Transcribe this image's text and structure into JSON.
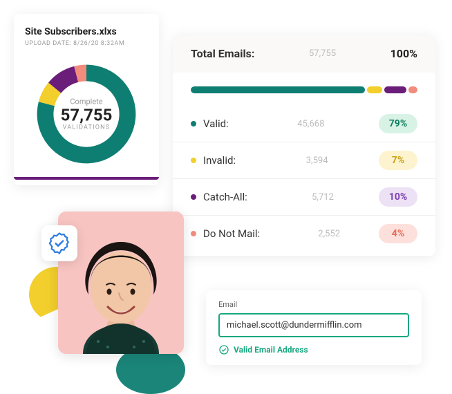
{
  "subs": {
    "title": "Site Subscribers.xlxs",
    "upload_meta": "UPLOAD DATE: 8/26/20 8:32AM",
    "complete_label": "Complete",
    "count": "57,755",
    "validations_label": "VALIDATIONS"
  },
  "totals": {
    "label": "Total Emails:",
    "count": "57,755",
    "percent": "100%",
    "rows": [
      {
        "label": "Valid:",
        "count": "45,668",
        "percent": "79%",
        "color": "#0f7e72",
        "pill": "pill-green"
      },
      {
        "label": "Invalid:",
        "count": "3,594",
        "percent": "7%",
        "color": "#f2cf2c",
        "pill": "pill-yellow"
      },
      {
        "label": "Catch-All:",
        "count": "5,712",
        "percent": "10%",
        "color": "#6b1d7a",
        "pill": "pill-purple"
      },
      {
        "label": "Do Not Mail:",
        "count": "2,552",
        "percent": "4%",
        "color": "#f28c7d",
        "pill": "pill-coral"
      }
    ]
  },
  "email": {
    "label": "Email",
    "value": "michael.scott@dundermifflin.com",
    "valid_msg": "Valid Email Address"
  },
  "chart_data": {
    "type": "pie",
    "title": "Site Subscribers.xlxs validation breakdown",
    "categories": [
      "Valid",
      "Invalid",
      "Catch-All",
      "Do Not Mail"
    ],
    "values": [
      79,
      7,
      10,
      4
    ],
    "colors": [
      "#0f7e72",
      "#f2cf2c",
      "#6b1d7a",
      "#f28c7d"
    ],
    "total": 57755
  }
}
